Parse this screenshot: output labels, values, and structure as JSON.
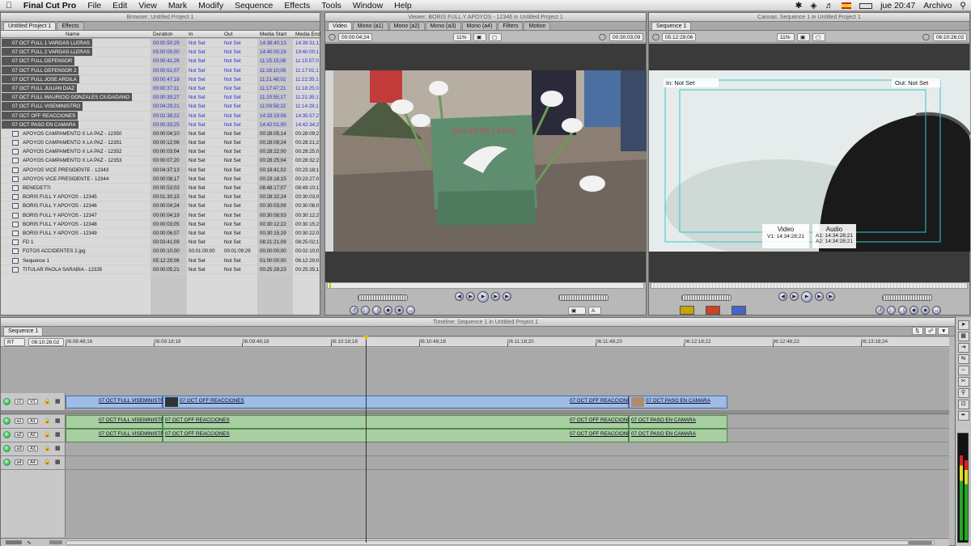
{
  "menubar": {
    "app": "Final Cut Pro",
    "items": [
      "File",
      "Edit",
      "View",
      "Mark",
      "Modify",
      "Sequence",
      "Effects",
      "Tools",
      "Window",
      "Help"
    ],
    "clock": "jue 20:47",
    "right_menu": "Archivo"
  },
  "browser": {
    "title": "Browser: Untitled Project 1",
    "tabs": [
      "Untitled Project 1",
      "Effects"
    ],
    "columns": [
      "Name",
      "Duration",
      "In",
      "Out",
      "Media Start",
      "Media End"
    ],
    "rows": [
      {
        "name": "07 OCT FULL 1 VARGAS LLERAS",
        "duration": "00:00:50;29",
        "in": "Not Set",
        "out": "Not Set",
        "start": "14:38:40;13",
        "end": "14:39:31;1",
        "sel": true,
        "blue": true
      },
      {
        "name": "07 OCT FULL 2 VARGAS LLERAS",
        "duration": "05:00:00;00",
        "in": "Not Set",
        "out": "Not Set",
        "start": "14:40:00;19",
        "end": "19:40:00;1",
        "sel": true,
        "blue": true
      },
      {
        "name": "07 OCT FULL DEFENSOR",
        "duration": "00:00:41;26",
        "in": "Not Set",
        "out": "Not Set",
        "start": "11:15:15;08",
        "end": "11:15:57;0",
        "sel": true,
        "blue": true
      },
      {
        "name": "07 OCT FULL DEFENSOR 2",
        "duration": "00:00:51;07",
        "in": "Not Set",
        "out": "Not Set",
        "start": "11:16:10;09",
        "end": "11:17:01;1",
        "sel": true,
        "blue": true
      },
      {
        "name": "07 OCT FULL JOSE ARDILA",
        "duration": "00:00:47;16",
        "in": "Not Set",
        "out": "Not Set",
        "start": "11:21:48;02",
        "end": "11:22:35;1",
        "sel": true,
        "blue": true
      },
      {
        "name": "07 OCT FULL JULIAN DIAZ",
        "duration": "00:00:37;11",
        "in": "Not Set",
        "out": "Not Set",
        "start": "11:17:47;21",
        "end": "11:18:25;0",
        "sel": true,
        "blue": true
      },
      {
        "name": "07 OCT FULL MAURICIO GONZALES CIUDADANO",
        "duration": "00:00:39;27",
        "in": "Not Set",
        "out": "Not Set",
        "start": "11:20:55;17",
        "end": "11:21:35;1",
        "sel": true,
        "blue": true
      },
      {
        "name": "07 OCT FULL VISEMINISTRO",
        "duration": "00:04:29;21",
        "in": "Not Set",
        "out": "Not Set",
        "start": "11:09:58;22",
        "end": "11:14:28;1",
        "sel": true,
        "blue": true
      },
      {
        "name": "07 OCT OFF REACCIONES",
        "duration": "00:02:38;22",
        "in": "Not Set",
        "out": "Not Set",
        "start": "14:33:19;06",
        "end": "14:35:57;2",
        "sel": true,
        "blue": true
      },
      {
        "name": "07 OCT PASO EN CAMARA",
        "duration": "00:00:33;25",
        "in": "Not Set",
        "out": "Not Set",
        "start": "14:42:01;00",
        "end": "14:42:34;2",
        "sel": true,
        "blue": true
      },
      {
        "name": "APOYOS CAMPAMENTO X LA PAZ - 12350",
        "duration": "00:00:04;10",
        "in": "Not Set",
        "out": "Not Set",
        "start": "00:28:05;14",
        "end": "00:28:09;2"
      },
      {
        "name": "APOYOS CAMPAMENTO X LA PAZ - 12351",
        "duration": "00:00:12;06",
        "in": "Not Set",
        "out": "Not Set",
        "start": "00:28:09;24",
        "end": "00:28:21;2"
      },
      {
        "name": "APOYOS CAMPAMENTO X LA PAZ - 12352",
        "duration": "00:00:03;04",
        "in": "Not Set",
        "out": "Not Set",
        "start": "00:28:22;00",
        "end": "00:28:25;0"
      },
      {
        "name": "APOYOS CAMPAMENTO X LA PAZ - 12353",
        "duration": "00:00:07;20",
        "in": "Not Set",
        "out": "Not Set",
        "start": "00:28:25;04",
        "end": "00:28:32;2"
      },
      {
        "name": "APOYOS VICE PRESIDENTE - 12343",
        "duration": "00:04:37;13",
        "in": "Not Set",
        "out": "Not Set",
        "start": "00:18:41;02",
        "end": "00:23:18;1"
      },
      {
        "name": "APOYOS VICE PRESIDENTE - 12344",
        "duration": "00:00:08;17",
        "in": "Not Set",
        "out": "Not Set",
        "start": "00:23:18;15",
        "end": "00:23:27;0"
      },
      {
        "name": "BENEDETTI",
        "duration": "00:00:53;03",
        "in": "Not Set",
        "out": "Not Set",
        "start": "08:48:17;07",
        "end": "08:49:10;1"
      },
      {
        "name": "BORIS FULL Y APOYOS - 12345",
        "duration": "00:01:30;15",
        "in": "Not Set",
        "out": "Not Set",
        "start": "00:28:32;24",
        "end": "00:30:03;0"
      },
      {
        "name": "BORIS FULL Y APOYOS - 12346",
        "duration": "00:00:04;24",
        "in": "Not Set",
        "out": "Not Set",
        "start": "00:30:03;09",
        "end": "00:30:08;0"
      },
      {
        "name": "BORIS FULL Y APOYOS - 12347",
        "duration": "00:00:04;19",
        "in": "Not Set",
        "out": "Not Set",
        "start": "00:30:08;03",
        "end": "00:30:12;2"
      },
      {
        "name": "BORIS FULL Y APOYOS - 12348",
        "duration": "00:00:03;05",
        "in": "Not Set",
        "out": "Not Set",
        "start": "00:30:12;22",
        "end": "00:30:15;2"
      },
      {
        "name": "BORIS FULL Y APOYOS - 12349",
        "duration": "00:00:06;07",
        "in": "Not Set",
        "out": "Not Set",
        "start": "00:30:15;29",
        "end": "00:30:22;0"
      },
      {
        "name": "FD 1",
        "duration": "00:03:41;09",
        "in": "Not Set",
        "out": "Not Set",
        "start": "08:21:21;09",
        "end": "08:25:02;1"
      },
      {
        "name": "FOTOS ACCIDENTES 2.jpg",
        "duration": "00:00:10;00",
        "in": "00:01:00;00",
        "out": "00:01:09;29",
        "start": "00:00:00;00",
        "end": "00:02:10;0"
      },
      {
        "name": "Sequence 1",
        "duration": "05:12:29;06",
        "in": "Not Set",
        "out": "Not Set",
        "start": "01:00:00;00",
        "end": "06:12:29;0"
      },
      {
        "name": "TITULAR PAOLA SARABIA - 12335",
        "duration": "00:00:05;21",
        "in": "Not Set",
        "out": "Not Set",
        "start": "00:25:29;23",
        "end": "00:25:35;1"
      }
    ]
  },
  "viewer": {
    "title": "Viewer: BORIS FULL Y APOYOS - 12346 in Untitled Project 1",
    "tabs": [
      "Video",
      "Mono (a1)",
      "Mono (a2)",
      "Mono (a3)",
      "Mono (a4)",
      "Filters",
      "Motion"
    ],
    "duration_tc": "00:00:04;24",
    "current_tc": "00:30:03;09",
    "zoom": "11%",
    "sign_text": "BOLSO DE LA PAZ"
  },
  "canvas": {
    "title": "Canvas: Sequence 1 in Untitled Project 1",
    "tab": "Sequence 1",
    "duration_tc": "05:12:29;06",
    "current_tc": "06:10:26;02",
    "zoom": "11%",
    "in_label": "In: Not Set",
    "out_label": "Out: Not Set",
    "video_label": "Video",
    "audio_label": "Audio",
    "v1": "V1: 14:34:28;21",
    "a1": "A1: 14:34:28;21",
    "a2": "A2: 14:34:28;21"
  },
  "timeline": {
    "title": "Timeline: Sequence 1 in Untitled Project 1",
    "tab": "Sequence 1",
    "rt": "RT",
    "current_tc": "06:10:26;02",
    "ruler": [
      "06:08:48;16",
      "06:09:18;18",
      "06:09:48;18",
      "06:10:18;18",
      "06:10:48;18",
      "06:11:18;20",
      "06:11:48;20",
      "06:12:18;22",
      "06:12:48;22",
      "06:13:18;24"
    ],
    "tracks": [
      "V1",
      "A1",
      "A2",
      "A3",
      "A4"
    ],
    "patches": [
      "v1",
      "a1",
      "a2",
      "a3",
      "a4"
    ],
    "clip_viseministro": "07 OCT FULL VISEMINISTRO",
    "clip_reacciones": "07 OCT OFF REACCIONES",
    "clip_paso": "07 OCT PASO EN CAMARA"
  },
  "colors": {
    "accent": "#3a78d8",
    "video_clip": "#9dbce6",
    "audio_clip": "#a7cfa1",
    "selection": "#555555"
  }
}
